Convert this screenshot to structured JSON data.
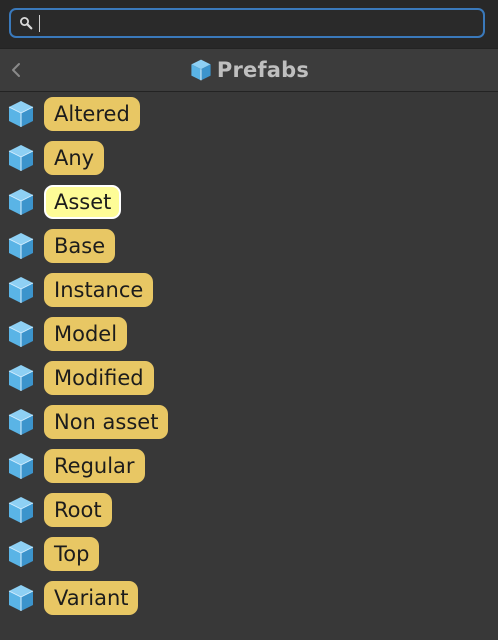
{
  "search": {
    "value": "",
    "placeholder": ""
  },
  "header": {
    "title": "Prefabs",
    "back_icon": "chevron-left-icon",
    "title_icon": "prefab-cube-icon"
  },
  "items": [
    {
      "label": "Altered",
      "selected": false
    },
    {
      "label": "Any",
      "selected": false
    },
    {
      "label": "Asset",
      "selected": true
    },
    {
      "label": "Base",
      "selected": false
    },
    {
      "label": "Instance",
      "selected": false
    },
    {
      "label": "Model",
      "selected": false
    },
    {
      "label": "Modified",
      "selected": false
    },
    {
      "label": "Non asset",
      "selected": false
    },
    {
      "label": "Regular",
      "selected": false
    },
    {
      "label": "Root",
      "selected": false
    },
    {
      "label": "Top",
      "selected": false
    },
    {
      "label": "Variant",
      "selected": false
    }
  ],
  "colors": {
    "chip": "#e8c764",
    "chip_selected": "#fefc97",
    "accent": "#3a79bb",
    "icon_blue": "#5ab4e6"
  }
}
